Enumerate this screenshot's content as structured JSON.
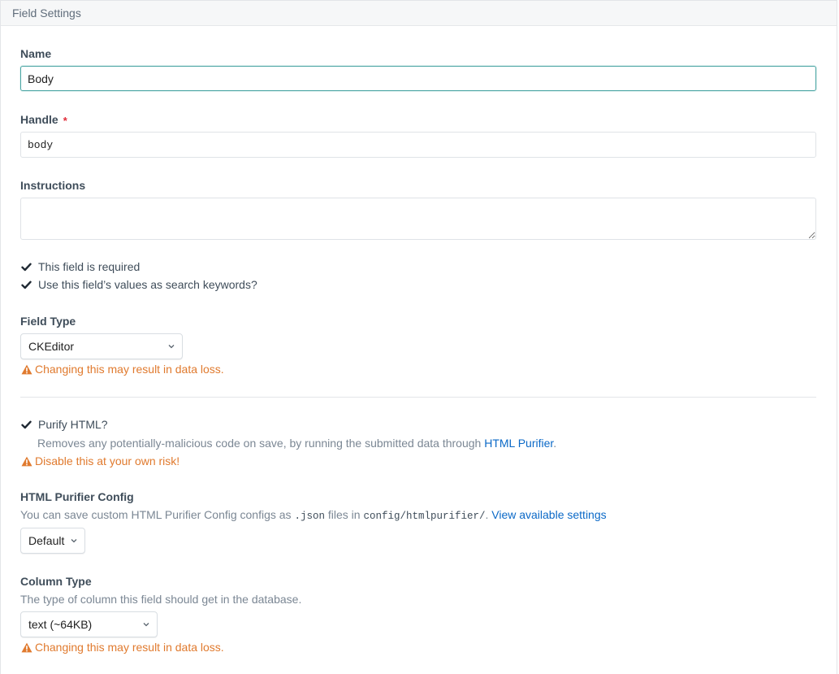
{
  "panel": {
    "title": "Field Settings"
  },
  "name": {
    "label": "Name",
    "value": "Body"
  },
  "handle": {
    "label": "Handle",
    "required_marker": "*",
    "value": "body"
  },
  "instructions": {
    "label": "Instructions",
    "value": ""
  },
  "checkboxes": {
    "required": {
      "label": "This field is required",
      "checked": true
    },
    "search_keywords": {
      "label": "Use this field’s values as search keywords?",
      "checked": true
    }
  },
  "field_type": {
    "label": "Field Type",
    "selected": "CKEditor",
    "warning": "Changing this may result in data loss."
  },
  "purify": {
    "label": "Purify HTML?",
    "checked": true,
    "description_prefix": "Removes any potentially-malicious code on save, by running the submitted data through ",
    "description_link": "HTML Purifier",
    "description_suffix": ".",
    "warning": "Disable this at your own risk!"
  },
  "purifier_config": {
    "label": "HTML Purifier Config",
    "desc_1": "You can save custom HTML Purifier Config configs as ",
    "desc_code_1": ".json",
    "desc_2": " files in ",
    "desc_code_2": "config/htmlpurifier/",
    "desc_3": ". ",
    "desc_link": "View available settings",
    "selected": "Default"
  },
  "column_type": {
    "label": "Column Type",
    "description": "The type of column this field should get in the database.",
    "selected": "text (~64KB)",
    "warning": "Changing this may result in data loss."
  },
  "colors": {
    "warning": "#e07a2e",
    "link": "#0b69c7",
    "required": "#e12d39",
    "focus": "#4aa5a3"
  },
  "icons": {
    "checkbox": "checkmark-icon",
    "warning": "warning-triangle-icon",
    "select": "chevron-down-icon"
  }
}
